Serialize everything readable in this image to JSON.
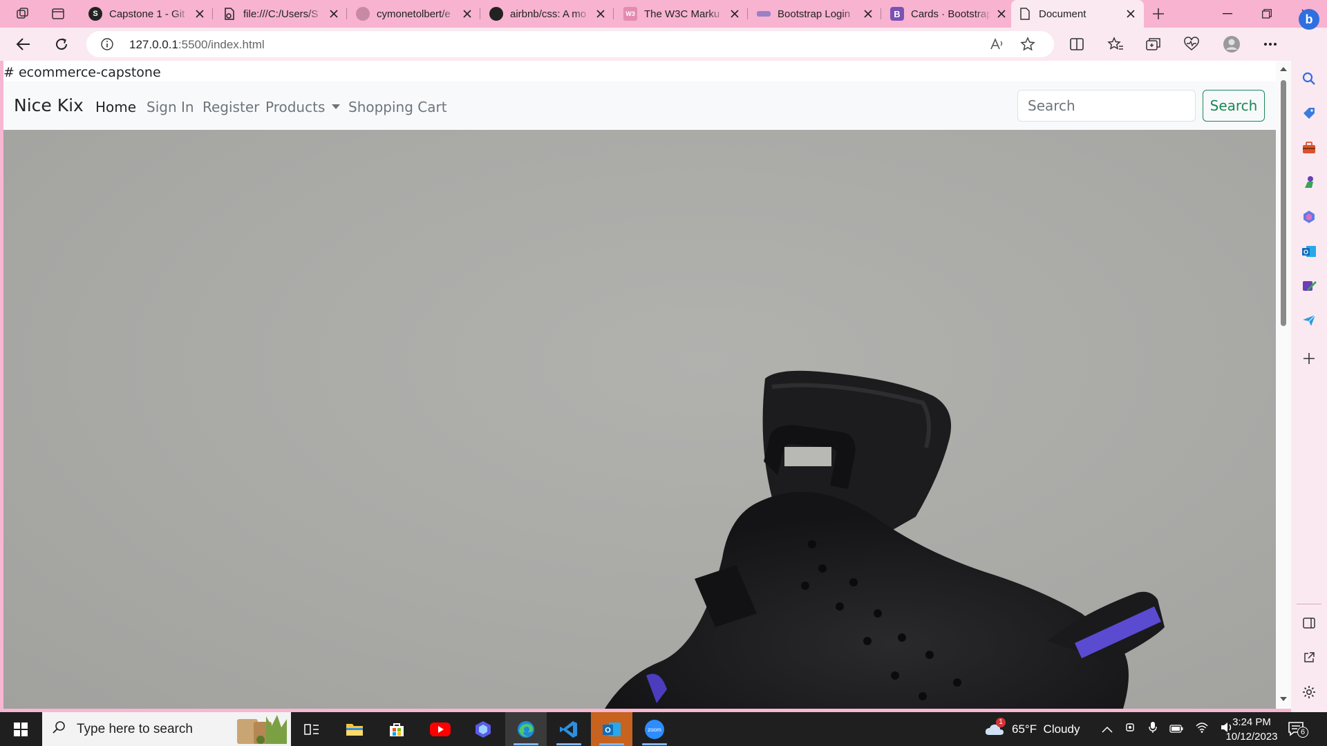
{
  "tabs": [
    {
      "title": "Capstone 1 - Git",
      "icon": "chatgpt-icon"
    },
    {
      "title": "file:///C:/Users/S",
      "icon": "pdf-icon"
    },
    {
      "title": "cymonetolbert/e",
      "icon": "github-icon"
    },
    {
      "title": "airbnb/css: A mo",
      "icon": "github-icon"
    },
    {
      "title": "The W3C Marku",
      "icon": "w3c-icon"
    },
    {
      "title": "Bootstrap Login",
      "icon": "bootstrap-site-icon"
    },
    {
      "title": "Cards · Bootstrap",
      "icon": "bootstrap-icon"
    },
    {
      "title": "Document",
      "icon": "document-icon",
      "active": true
    }
  ],
  "address_bar": {
    "host": "127.0.0.1",
    "path": ":5500/index.html"
  },
  "page": {
    "readme_heading": "# ecommerce-capstone",
    "navbar": {
      "brand": "Nice Kix",
      "links": [
        "Home",
        "Sign In",
        "Register",
        "Products",
        "Shopping Cart"
      ],
      "active_link": "Home",
      "search_placeholder": "Search",
      "search_button": "Search",
      "search_button_color": "#198754"
    }
  },
  "taskbar": {
    "search_placeholder": "Type here to search",
    "weather": "65°F  Cloudy",
    "weather_alerts": "1",
    "time": "3:24 PM",
    "date": "10/12/2023",
    "notifications": "6"
  },
  "colors": {
    "browser_frame": "#f7b3d0",
    "toolbar": "#fbe9f1",
    "taskbar": "#1f1f1f"
  }
}
